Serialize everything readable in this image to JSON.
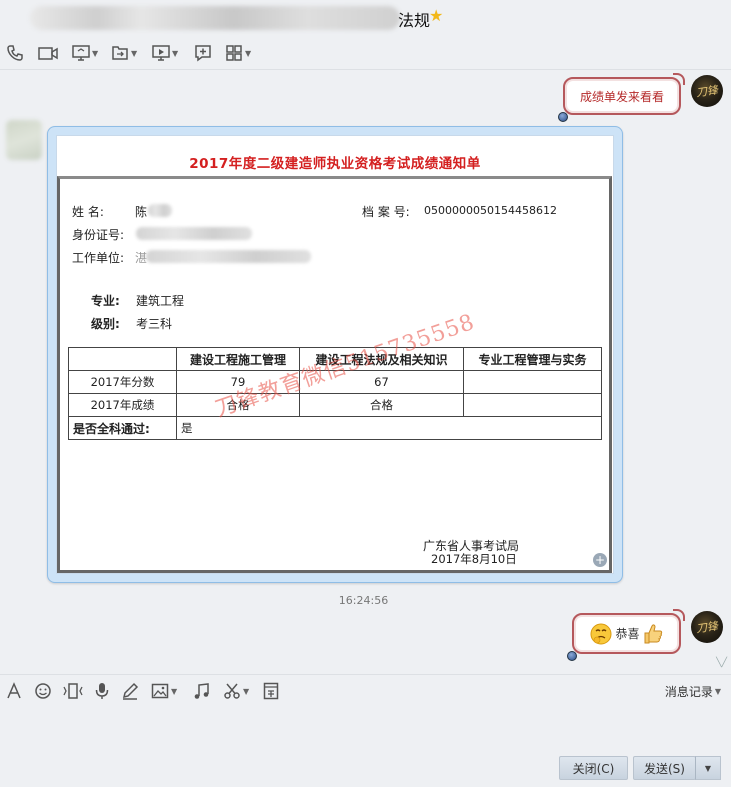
{
  "window": {
    "title_suffix": "法规",
    "star_icon": "star-icon"
  },
  "toolbar": {
    "items": [
      "phone-icon",
      "video-icon",
      "screen-share-icon",
      "send-file-icon",
      "remote-assist-icon",
      "add-app-icon",
      "more-apps-icon"
    ]
  },
  "messages": {
    "first_text": "成绩单发来看看",
    "timestamp": "16:24:56",
    "congrats_text": "恭喜",
    "avatar_glyph": "刀锋"
  },
  "document": {
    "title": "2017年度二级建造师执业资格考试成绩通知单",
    "name_label": "姓    名:",
    "name_value": "陈",
    "file_no_label": "档 案 号:",
    "file_no_value": "0500000050154458612",
    "id_label": "身份证号:",
    "work_label": "工作单位:",
    "work_value": "湛",
    "major_label": "专业:",
    "major_value": "建筑工程",
    "level_label": "级别:",
    "level_value": "考三科",
    "table": {
      "headers": [
        "",
        "建设工程施工管理",
        "建设工程法规及相关知识",
        "专业工程管理与实务"
      ],
      "rows": [
        [
          "2017年分数",
          "79",
          "67",
          ""
        ],
        [
          "2017年成绩",
          "合格",
          "合格",
          ""
        ]
      ],
      "pass_label": "是否全科通过:",
      "pass_value": "是"
    },
    "issuer": "广东省人事考试局",
    "date": "2017年8月10日",
    "watermark": "刀锋教育微信515735558"
  },
  "input_toolbar": {
    "history_label": "消息记录"
  },
  "buttons": {
    "close_label": "关闭(C)",
    "send_label": "发送(S)"
  }
}
